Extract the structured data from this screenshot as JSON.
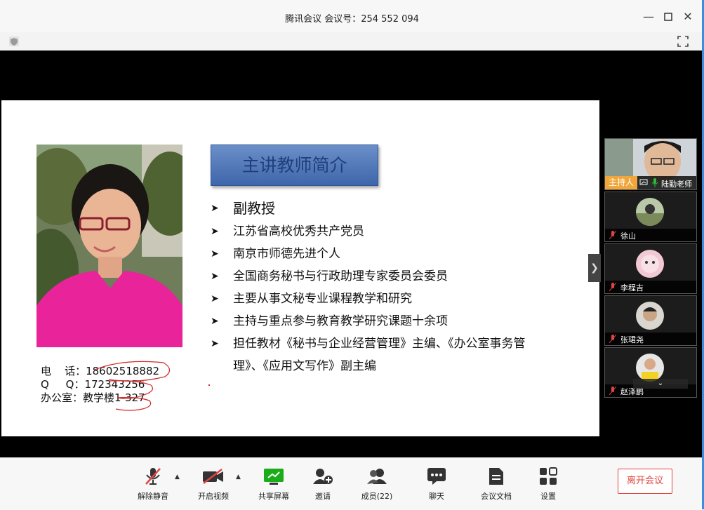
{
  "window": {
    "title": "腾讯会议 会议号：254 552 094"
  },
  "slide": {
    "heading": "主讲教师简介",
    "bullets": [
      "副教授",
      "江苏省高校优秀共产党员",
      "南京市师德先进个人",
      "全国商务秘书与行政助理专家委员会委员",
      "主要从事文秘专业课程教学和研究",
      "主持与重点参与教育教学研究课题十余项",
      "担任教材《秘书与企业经营管理》主编、《办公室事务管",
      "理》、《应用文写作》副主编"
    ],
    "contact": {
      "phone": "电    话：18602518882",
      "qq": "Q     Q：172343256",
      "office": "办公室：教学楼1-327"
    }
  },
  "participants": {
    "host_label": "主持人",
    "items": [
      {
        "name": "陆勤老师",
        "role": "host"
      },
      {
        "name": "徐山"
      },
      {
        "name": "李程吉"
      },
      {
        "name": "张珺尧"
      },
      {
        "name": "赵泽鹏"
      }
    ]
  },
  "toolbar": {
    "mute": "解除静音",
    "video": "开启视频",
    "share": "共享屏幕",
    "invite": "邀请",
    "members": "成员(22)",
    "chat": "聊天",
    "docs": "会议文档",
    "settings": "设置",
    "leave": "离开会议"
  },
  "colors": {
    "accent": "#1aad19",
    "leave": "#e0443c",
    "host_tag": "#f0a63a",
    "heading_bg": "#4f73b6"
  }
}
